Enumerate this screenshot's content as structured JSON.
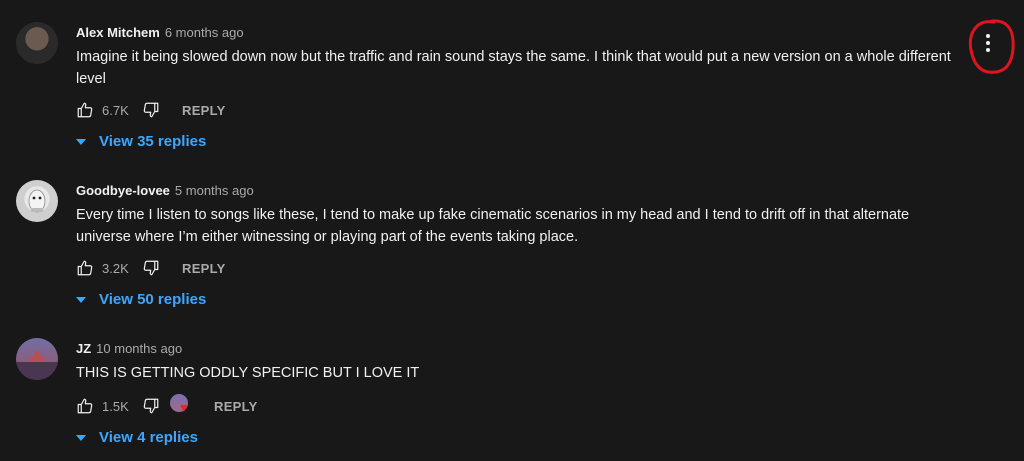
{
  "comments": [
    {
      "author": "Alex Mitchem",
      "time": "6 months ago",
      "text": "Imagine it being slowed down now but the traffic and rain sound stays the same. I think that would put a new version on a whole different level",
      "likes": "6.7K",
      "reply_label": "REPLY",
      "view_replies": "View 35 replies"
    },
    {
      "author": "Goodbye-lovee",
      "time": "5 months ago",
      "text": "Every time I listen to songs like these, I tend to make up fake cinematic scenarios in my head and I tend to drift off in that alternate universe where I’m either  witnessing or playing part of the events taking place.",
      "likes": "3.2K",
      "reply_label": "REPLY",
      "view_replies": "View 50 replies"
    },
    {
      "author": "JZ",
      "time": "10 months ago",
      "text": "THIS IS GETTING ODDLY SPECIFIC BUT I LOVE IT",
      "likes": "1.5K",
      "reply_label": "REPLY",
      "view_replies": "View 4 replies"
    }
  ],
  "icons": {
    "like": "thumb-up-icon",
    "dislike": "thumb-down-icon",
    "more": "more-vertical-icon",
    "caret": "caret-down-icon",
    "creator_heart": "heart-icon"
  },
  "colors": {
    "background": "#181818",
    "link": "#3ea6ff",
    "annotation_circle": "#e0141e",
    "heart": "#e3272c"
  }
}
